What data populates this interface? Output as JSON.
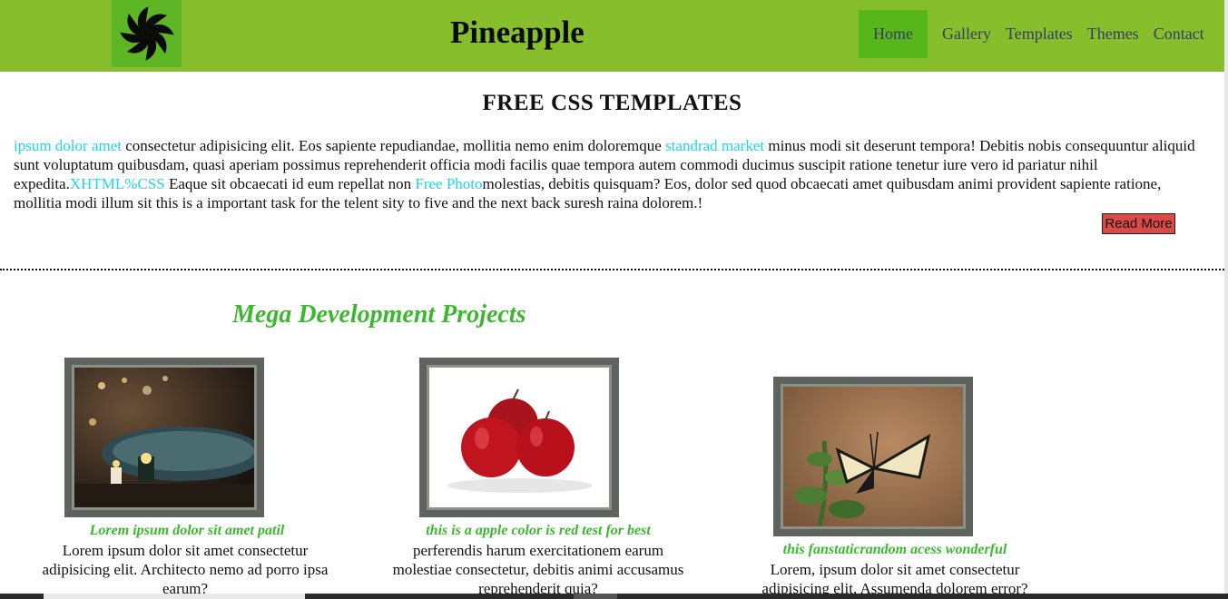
{
  "header": {
    "site_title": "Pineapple",
    "logo_icon": "pinwheel-icon",
    "nav": [
      "Home",
      "Gallery",
      "Templates",
      "Themes",
      "Contact"
    ],
    "active_nav": "Home",
    "colors": {
      "header_bg": "#86bf2b",
      "active_bg": "#56b61a"
    }
  },
  "intro": {
    "title": "FREE CSS TEMPLATES",
    "link1": "ipsum dolor amet",
    "text1": " consectetur adipisicing elit. Eos sapiente repudiandae, mollitia nemo enim doloremque ",
    "link2": "standrad market",
    "text2": " minus modi sit deserunt tempora! Debitis nobis consequuntur aliquid sunt voluptatum quibusdam, quasi aperiam possimus reprehenderit officia modi facilis quae tempora autem commodi ducimus suscipit ratione tenetur iure vero id pariatur nihil expedita.",
    "link3": "XHTML%CSS",
    "text3": " Eaque sit obcaecati id eum repellat non ",
    "link4": "Free Photo",
    "text4": "molestias, debitis quisquam? Eos, dolor sed quod obcaecati amet quibusdam animi provident sapiente ratione, mollitia modi illum sit this is a important task for the telent sity to five and the next back suresh raina dolorem.!",
    "read_more": "Read More"
  },
  "projects": {
    "title": "Mega Development Projects",
    "items": [
      {
        "image": "bath-candles-image",
        "caption": "Lorem ipsum dolor sit amet patil",
        "desc": "Lorem ipsum dolor sit amet consectetur adipisicing elit. Architecto nemo ad porro ipsa earum?"
      },
      {
        "image": "red-apples-image",
        "caption": "this is a apple color is red test for best",
        "desc": "perferendis harum exercitationem earum molestiae consectetur, debitis animi accusamus reprehenderit quia?"
      },
      {
        "image": "butterfly-image",
        "caption": "this fanstaticrandom acess wonderful",
        "desc": "Lorem, ipsum dolor sit amet consectetur adipisicing elit. Assumenda dolorem error?"
      }
    ]
  }
}
